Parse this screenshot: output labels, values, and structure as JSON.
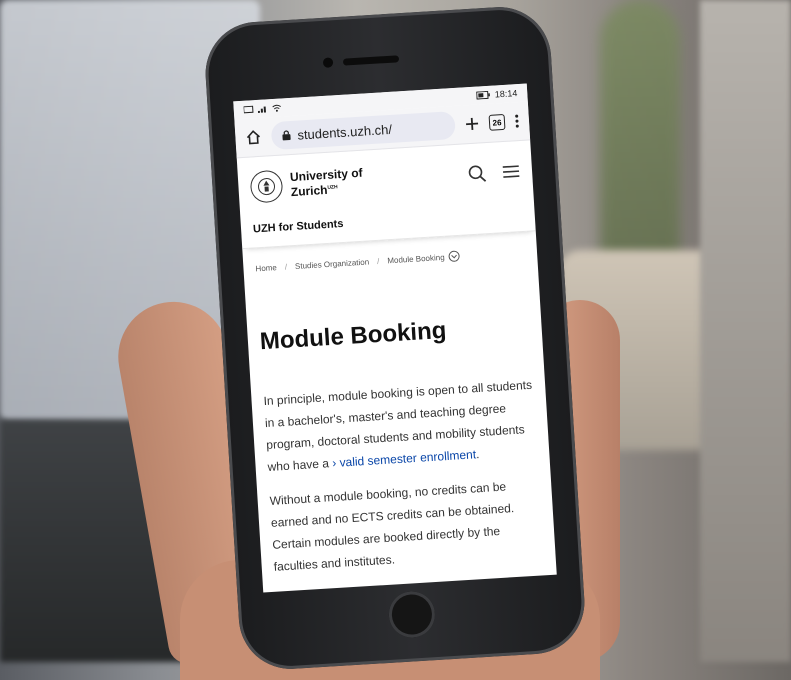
{
  "status_bar": {
    "time": "18:14"
  },
  "browser": {
    "url": "students.uzh.ch/",
    "tab_count": "26"
  },
  "site": {
    "logo_text_line1": "University of",
    "logo_text_line2": "Zurich",
    "logo_superscript": "UZH",
    "section_title": "UZH for Students"
  },
  "breadcrumb": {
    "items": [
      "Home",
      "Studies Organization",
      "Module Booking"
    ]
  },
  "page": {
    "title": "Module Booking",
    "para1_text": "In principle, module booking is open to all students in a bachelor's, master's and teaching degree program, doctoral students and mobility students who have a",
    "para1_link": "› valid semester enrollment",
    "para1_end": ".",
    "para2": "Without a module booking, no credits can be earned and no ECTS credits can be obtained. Certain modules are booked directly by the faculties and institutes."
  },
  "colors": {
    "link": "#0a46a8",
    "url_bar": "#e8e9f2"
  }
}
